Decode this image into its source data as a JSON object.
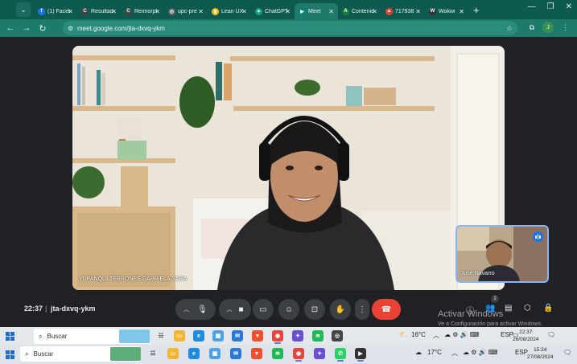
{
  "browser": {
    "tabs": [
      {
        "label": "(1) Facebook",
        "color": "#1877f2",
        "glyph": "f"
      },
      {
        "label": "Resultados",
        "color": "#e8eaed",
        "glyph": "C"
      },
      {
        "label": "Reimorph",
        "color": "#e8eaed",
        "glyph": "C"
      },
      {
        "label": "upc-pre",
        "color": "#9aa0a6",
        "glyph": "◎"
      },
      {
        "label": "Lean UX",
        "color": "#fbbc04",
        "glyph": "▮"
      },
      {
        "label": "ChatGPT",
        "color": "#10a37f",
        "glyph": "✦"
      },
      {
        "label": "Meet",
        "color": "#00897b",
        "glyph": "▶",
        "active": true
      },
      {
        "label": "Contenido",
        "color": "#188038",
        "glyph": "A"
      },
      {
        "label": "717938",
        "color": "#ea4335",
        "glyph": "▲"
      },
      {
        "label": "Wokwi",
        "color": "#333333",
        "glyph": "W"
      }
    ],
    "url": "meet.google.com/jta-dxvq-ykm",
    "profile_initial": "J",
    "new_tab_glyph": "+"
  },
  "meet": {
    "main_participant": "YUPANQUI TERRONES GABRIELA SARA",
    "self_participant": "José Navarro",
    "time": "22:37",
    "separator": "|",
    "meeting_code": "jta-dxvq-ykm",
    "people_count": "2"
  },
  "watermark": {
    "title": "Activar Windows",
    "subtitle": "Ve a Configuración para activar Windows."
  },
  "taskbar_top": {
    "search_placeholder": "Buscar",
    "weather": "16°C",
    "lang": "ESP",
    "time": "22:37",
    "date": "26/08/2024",
    "notif": "1"
  },
  "taskbar_bottom": {
    "search_placeholder": "Buscar",
    "weather": "17°C",
    "lang": "ESP",
    "time": "15:24",
    "date": "27/08/2024",
    "notif": "1"
  },
  "colors": {
    "browser_accent": "#1e7a6a",
    "meet_bg": "#202124",
    "hangup": "#ea4335",
    "self_border": "#8ab4f8"
  }
}
